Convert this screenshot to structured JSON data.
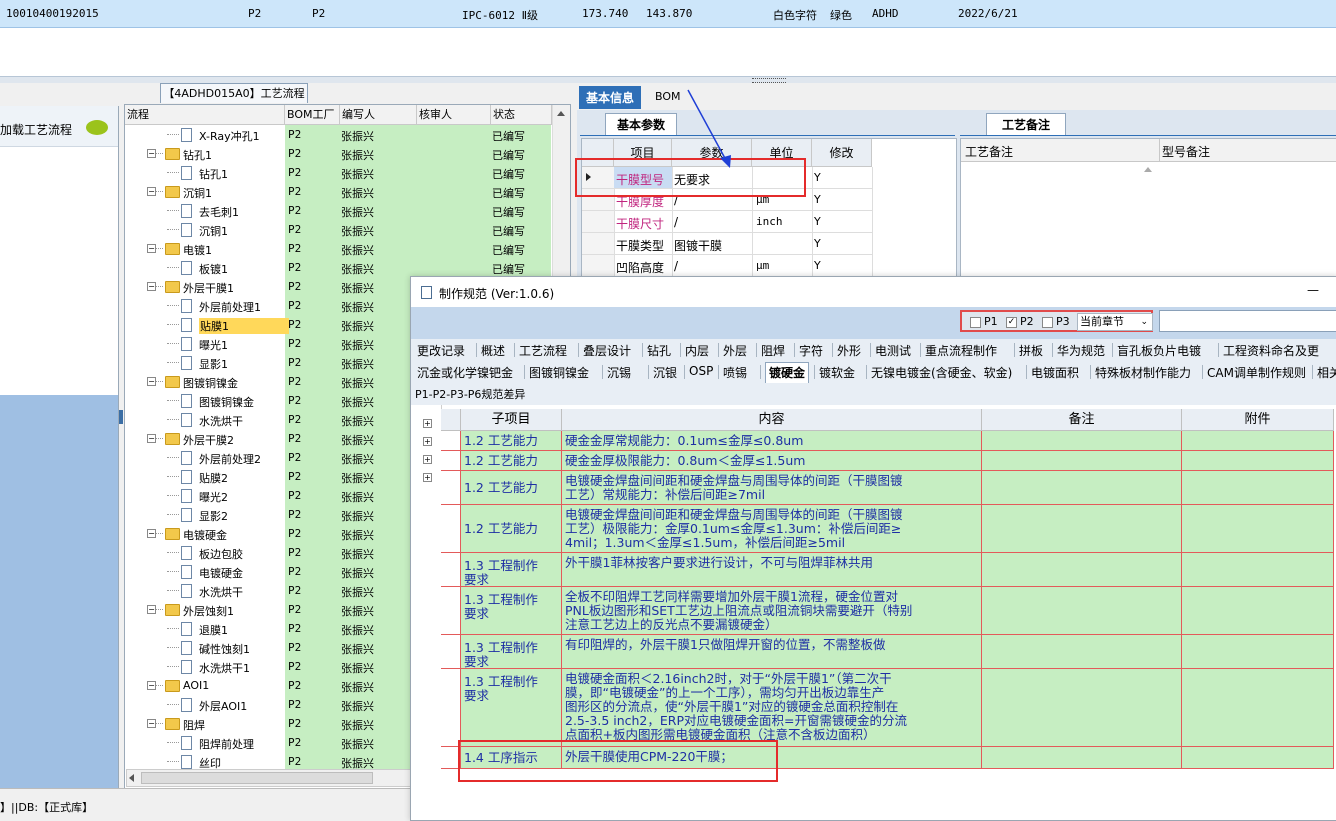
{
  "top_record": {
    "code": "10010400192015",
    "factory1": "P2",
    "factory2": "P2",
    "grade": "IPC-6012 Ⅱ级",
    "value1": "173.740",
    "value2": "143.870",
    "text": "白色字符",
    "color": "绿色",
    "abbr": "ADHD",
    "date": "2022/6/21"
  },
  "left_panel": {
    "label": "加载工艺流程"
  },
  "tree": {
    "tab_title": "【4ADHD015A0】工艺流程",
    "headers": [
      "流程",
      "BOM工厂",
      "编写人",
      "核审人",
      "状态"
    ],
    "rows": [
      {
        "level": 2,
        "name": "X-Ray冲孔1",
        "factory": "P2",
        "author": "张振兴",
        "status": "已编写"
      },
      {
        "level": 1,
        "name": "钻孔1",
        "factory": "P2",
        "author": "张振兴",
        "status": "已编写"
      },
      {
        "level": 2,
        "name": "钻孔1",
        "factory": "P2",
        "author": "张振兴",
        "status": "已编写"
      },
      {
        "level": 1,
        "name": "沉铜1",
        "factory": "P2",
        "author": "张振兴",
        "status": "已编写"
      },
      {
        "level": 2,
        "name": "去毛刺1",
        "factory": "P2",
        "author": "张振兴",
        "status": "已编写"
      },
      {
        "level": 2,
        "name": "沉铜1",
        "factory": "P2",
        "author": "张振兴",
        "status": "已编写"
      },
      {
        "level": 1,
        "name": "电镀1",
        "factory": "P2",
        "author": "张振兴",
        "status": "已编写"
      },
      {
        "level": 2,
        "name": "板镀1",
        "factory": "P2",
        "author": "张振兴",
        "status": "已编写"
      },
      {
        "level": 1,
        "name": "外层干膜1",
        "factory": "P2",
        "author": "张振兴",
        "status": ""
      },
      {
        "level": 2,
        "name": "外层前处理1",
        "factory": "P2",
        "author": "张振兴",
        "status": ""
      },
      {
        "level": 2,
        "name": "贴膜1",
        "factory": "P2",
        "author": "张振兴",
        "status": "",
        "selected": true
      },
      {
        "level": 2,
        "name": "曝光1",
        "factory": "P2",
        "author": "张振兴",
        "status": ""
      },
      {
        "level": 2,
        "name": "显影1",
        "factory": "P2",
        "author": "张振兴",
        "status": ""
      },
      {
        "level": 1,
        "name": "图镀铜镍金",
        "factory": "P2",
        "author": "张振兴",
        "status": ""
      },
      {
        "level": 2,
        "name": "图镀铜镍金",
        "factory": "P2",
        "author": "张振兴",
        "status": ""
      },
      {
        "level": 2,
        "name": "水洗烘干",
        "factory": "P2",
        "author": "张振兴",
        "status": ""
      },
      {
        "level": 1,
        "name": "外层干膜2",
        "factory": "P2",
        "author": "张振兴",
        "status": ""
      },
      {
        "level": 2,
        "name": "外层前处理2",
        "factory": "P2",
        "author": "张振兴",
        "status": ""
      },
      {
        "level": 2,
        "name": "贴膜2",
        "factory": "P2",
        "author": "张振兴",
        "status": ""
      },
      {
        "level": 2,
        "name": "曝光2",
        "factory": "P2",
        "author": "张振兴",
        "status": ""
      },
      {
        "level": 2,
        "name": "显影2",
        "factory": "P2",
        "author": "张振兴",
        "status": ""
      },
      {
        "level": 1,
        "name": "电镀硬金",
        "factory": "P2",
        "author": "张振兴",
        "status": ""
      },
      {
        "level": 2,
        "name": "板边包胶",
        "factory": "P2",
        "author": "张振兴",
        "status": ""
      },
      {
        "level": 2,
        "name": "电镀硬金",
        "factory": "P2",
        "author": "张振兴",
        "status": ""
      },
      {
        "level": 2,
        "name": "水洗烘干",
        "factory": "P2",
        "author": "张振兴",
        "status": ""
      },
      {
        "level": 1,
        "name": "外层蚀刻1",
        "factory": "P2",
        "author": "张振兴",
        "status": ""
      },
      {
        "level": 2,
        "name": "退膜1",
        "factory": "P2",
        "author": "张振兴",
        "status": ""
      },
      {
        "level": 2,
        "name": "碱性蚀刻1",
        "factory": "P2",
        "author": "张振兴",
        "status": ""
      },
      {
        "level": 2,
        "name": "水洗烘干1",
        "factory": "P2",
        "author": "张振兴",
        "status": ""
      },
      {
        "level": 1,
        "name": "AOI1",
        "factory": "P2",
        "author": "张振兴",
        "status": ""
      },
      {
        "level": 2,
        "name": "外层AOI1",
        "factory": "P2",
        "author": "张振兴",
        "status": ""
      },
      {
        "level": 1,
        "name": "阻焊",
        "factory": "P2",
        "author": "张振兴",
        "status": ""
      },
      {
        "level": 2,
        "name": "阻焊前处理",
        "factory": "P2",
        "author": "张振兴",
        "status": ""
      },
      {
        "level": 2,
        "name": "丝印",
        "factory": "P2",
        "author": "张振兴",
        "status": ""
      }
    ]
  },
  "status_bar": {
    "text": "】||DB:【正式库】"
  },
  "base_info": {
    "tabs": [
      "基本信息",
      "BOM"
    ],
    "param_tab": "基本参数",
    "note_tab": "工艺备注",
    "param_headers": [
      "项目",
      "参数",
      "单位",
      "修改"
    ],
    "params": [
      {
        "item": "干膜型号",
        "value": "无要求",
        "unit": "",
        "edit": "Y",
        "pink": true
      },
      {
        "item": "干膜厚度",
        "value": "/",
        "unit": "μm",
        "edit": "Y",
        "pink": true
      },
      {
        "item": "干膜尺寸",
        "value": "/",
        "unit": "inch",
        "edit": "Y",
        "pink": true
      },
      {
        "item": "干膜类型",
        "value": "图镀干膜",
        "unit": "",
        "edit": "Y",
        "pink": false
      },
      {
        "item": "凹陷高度",
        "value": "/",
        "unit": "μm",
        "edit": "Y",
        "pink": false
      }
    ],
    "note_headers": [
      "工艺备注",
      "型号备注"
    ]
  },
  "modal": {
    "title": "制作规范 (Ver:1.0.6)",
    "minimize": "—",
    "checks": [
      {
        "label": "P1",
        "checked": false
      },
      {
        "label": "P2",
        "checked": true
      },
      {
        "label": "P3",
        "checked": false
      }
    ],
    "chapter_select": "当前章节",
    "menu_row1": [
      "更改记录",
      "概述",
      "工艺流程",
      "叠层设计",
      "钻孔",
      "内层",
      "外层",
      "阻焊",
      "字符",
      "外形",
      "电测试",
      "重点流程制作",
      "拼板",
      "华为规范",
      "盲孔板负片电镀",
      "工程资料命名及更"
    ],
    "menu_row2": [
      "沉金或化学镍钯金",
      "图镀铜镍金",
      "沉锡",
      "沉银",
      "OSP",
      "喷锡",
      "镀硬金",
      "镀软金",
      "无镍电镀金(含硬金、软金)",
      "电镀面积",
      "特殊板材制作能力",
      "CAM调单制作规则",
      "相关"
    ],
    "menu_row2_selected": "镀硬金",
    "menu_row3": "P1-P2-P3-P6规范差异",
    "grid_headers": [
      "子项目",
      "内容",
      "备注",
      "附件"
    ],
    "grid_rows": [
      {
        "sub": "1.2 工艺能力",
        "content": "硬金金厚常规能力：0.1um≤金厚≤0.8um"
      },
      {
        "sub": "1.2 工艺能力",
        "content": "硬金金厚极限能力：0.8um＜金厚≤1.5um"
      },
      {
        "sub": "1.2 工艺能力",
        "content": "电镀硬金焊盘间间距和硬金焊盘与周围导体的间距（干膜图镀\n工艺）常规能力：补偿后间距≥7mil"
      },
      {
        "sub": "1.2 工艺能力",
        "content": "电镀硬金焊盘间间距和硬金焊盘与周围导体的间距（干膜图镀\n工艺）极限能力：金厚0.1um≤金厚≤1.3um：补偿后间距≥\n4mil；1.3um＜金厚≤1.5um，补偿后间距≥5mil"
      },
      {
        "sub": "1.3 工程制作\n要求",
        "content": "外干膜1菲林按客户要求进行设计，不可与阻焊菲林共用"
      },
      {
        "sub": "1.3 工程制作\n要求",
        "content": "全板不印阻焊工艺同样需要增加外层干膜1流程，硬金位置对\nPNL板边图形和SET工艺边上阻流点或阻流铜块需要避开（特别\n注意工艺边上的反光点不要漏镀硬金）"
      },
      {
        "sub": "1.3 工程制作\n要求",
        "content": "有印阻焊的，外层干膜1只做阻焊开窗的位置，不需整板做"
      },
      {
        "sub": "1.3 工程制作\n要求",
        "content": "电镀硬金面积＜2.16inch2时，对于“外层干膜1”（第二次干\n膜，即“电镀硬金”的上一个工序），需均匀开出板边靠生产\n图形区的分流点，使“外层干膜1”对应的镀硬金总面积控制在\n2.5-3.5 inch2，ERP对应电镀硬金面积=开窗需镀硬金的分流\n点面积+板内图形需电镀硬金面积（注意不含板边面积）"
      },
      {
        "sub": "1.4 工序指示",
        "content": "外层干膜使用CPM-220干膜；"
      }
    ]
  }
}
